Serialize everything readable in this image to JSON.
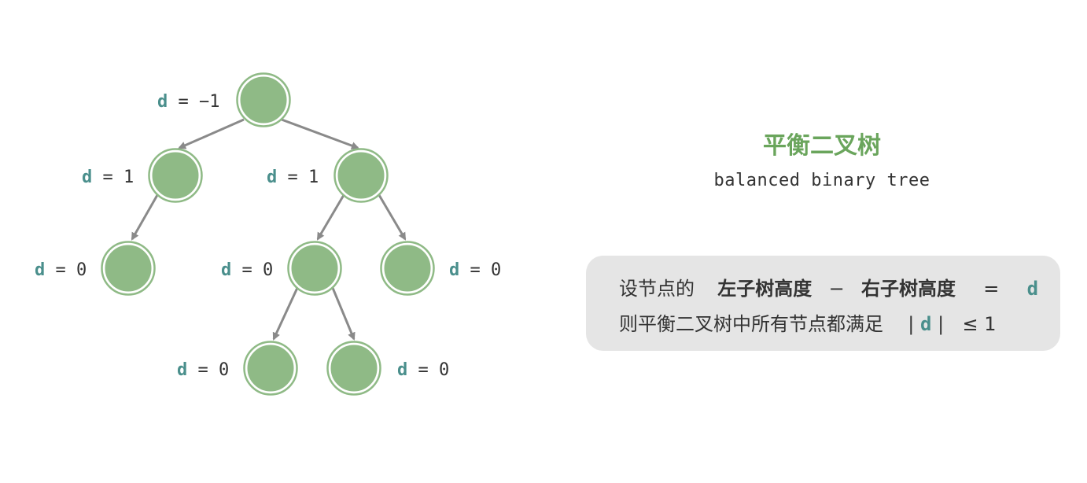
{
  "colors": {
    "node": "#8fba86",
    "title": "#6aa55c",
    "d_variable": "#4a8f8c",
    "edge": "#8a8a8a",
    "box": "#e5e5e5"
  },
  "tree": {
    "nodes": [
      {
        "id": "root",
        "d_var": "d",
        "d_rest": " = −1"
      },
      {
        "id": "left",
        "d_var": "d",
        "d_rest": " = 1"
      },
      {
        "id": "right",
        "d_var": "d",
        "d_rest": " = 1"
      },
      {
        "id": "left-left",
        "d_var": "d",
        "d_rest": " = 0"
      },
      {
        "id": "right-left",
        "d_var": "d",
        "d_rest": " = 0"
      },
      {
        "id": "right-right",
        "d_var": "d",
        "d_rest": " = 0"
      },
      {
        "id": "right-left-left",
        "d_var": "d",
        "d_rest": " = 0"
      },
      {
        "id": "right-left-right",
        "d_var": "d",
        "d_rest": " = 0"
      }
    ]
  },
  "title": "平衡二叉树",
  "subtitle": "balanced binary tree",
  "definition": {
    "line1_prefix": "设节点的",
    "line1_left": "左子树高度",
    "line1_minus": "−",
    "line1_right": "右子树高度",
    "line1_eq": "=",
    "line1_var": "d",
    "line2_prefix": "则平衡二叉树中所有节点都满足",
    "line2_bar_open": "|",
    "line2_var": "d",
    "line2_bar_close": "|",
    "line2_rest": "≤ 1"
  }
}
